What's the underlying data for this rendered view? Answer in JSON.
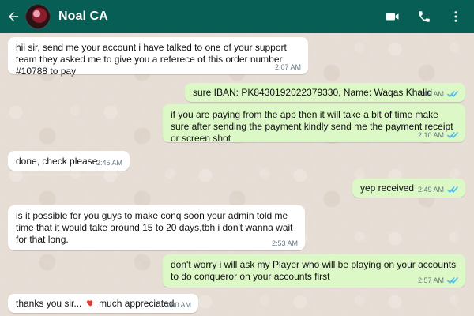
{
  "header": {
    "title": "Noal CA",
    "back_icon": "back-arrow-icon",
    "video_icon": "video-camera-icon",
    "call_icon": "phone-icon",
    "menu_icon": "more-vert-icon"
  },
  "messages": [
    {
      "direction": "incoming",
      "text": "hii sir, send me your account i have talked to one of your support team they asked me to give you a referece of this order number #10788 to pay",
      "time": "2:07 AM"
    },
    {
      "direction": "outgoing",
      "text": "sure IBAN: PK8430192022379330, Name: Waqas Khalid",
      "time": "2:09 AM"
    },
    {
      "direction": "outgoing",
      "text": "if you are paying from the app then it will take a bit of time make sure after sending the payment kindly send me the payment receipt or screen shot",
      "time": "2:10 AM"
    },
    {
      "direction": "incoming",
      "text": "done, check please",
      "time": "2:45 AM"
    },
    {
      "direction": "outgoing",
      "text": "yep received",
      "time": "2:49 AM"
    },
    {
      "direction": "incoming",
      "text": "is it possible for you guys to make conq soon your admin told me time that it would take around 15 to 20 days,tbh i don't wanna wait for that long.",
      "time": "2:53 AM"
    },
    {
      "direction": "outgoing",
      "text": "don't worry i will ask my Player who will be playing on your accounts to do conqueror on your accounts first",
      "time": "2:57 AM"
    },
    {
      "direction": "incoming",
      "text_before": "thanks you sir...",
      "text_after": "much appreciated",
      "time": "3:00 AM"
    }
  ]
}
